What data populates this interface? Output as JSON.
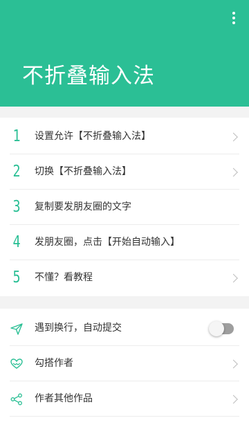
{
  "header": {
    "title": "不折叠输入法",
    "menu_icon": "more-vert-icon",
    "background_color": "#2bbf95"
  },
  "steps": [
    {
      "number": "1",
      "label": "设置允许【不折叠输入法】",
      "has_chevron": true
    },
    {
      "number": "2",
      "label": "切换【不折叠输入法】",
      "has_chevron": true
    },
    {
      "number": "3",
      "label": "复制要发朋友圈的文字",
      "has_chevron": false
    },
    {
      "number": "4",
      "label": "发朋友圈，点击【开始自动输入】",
      "has_chevron": false
    },
    {
      "number": "5",
      "label": "不懂？看教程",
      "has_chevron": true
    }
  ],
  "settings": [
    {
      "icon": "send-icon",
      "label": "遇到换行，自动提交",
      "control": "toggle",
      "toggle_on": false
    },
    {
      "icon": "heart-hands-icon",
      "label": "勾搭作者",
      "control": "chevron"
    },
    {
      "icon": "share-icon",
      "label": "作者其他作品",
      "control": "chevron"
    }
  ],
  "accent_color": "#2bbf95"
}
